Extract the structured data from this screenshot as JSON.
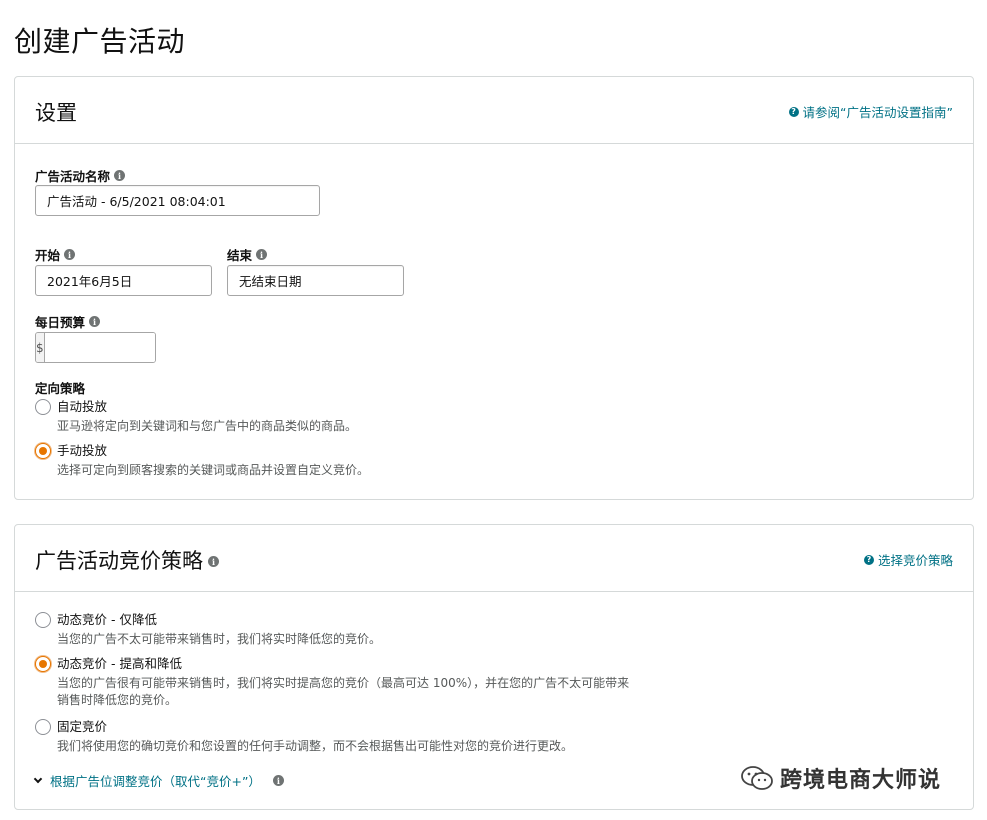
{
  "page_title": "创建广告活动",
  "settings": {
    "title": "设置",
    "help_link": "请参阅“广告活动设置指南”",
    "campaign_name_label": "广告活动名称",
    "campaign_name_value": "广告活动 - 6/5/2021 08:04:01",
    "start_label": "开始",
    "start_value": "2021年6月5日",
    "end_label": "结束",
    "end_value": "无结束日期",
    "budget_label": "每日预算",
    "currency": "$",
    "budget_value": "",
    "targeting_label": "定向策略",
    "targeting_options": [
      {
        "label": "自动投放",
        "desc": "亚马逊将定向到关键词和与您广告中的商品类似的商品。",
        "selected": false
      },
      {
        "label": "手动投放",
        "desc": "选择可定向到顾客搜索的关键词或商品并设置自定义竞价。",
        "selected": true
      }
    ]
  },
  "bidding": {
    "title": "广告活动竞价策略",
    "help_link": "选择竞价策略",
    "options": [
      {
        "label": "动态竞价 - 仅降低",
        "desc": "当您的广告不太可能带来销售时，我们将实时降低您的竞价。",
        "selected": false
      },
      {
        "label": "动态竞价 - 提高和降低",
        "desc": "当您的广告很有可能带来销售时，我们将实时提高您的竞价（最高可达 100%），并在您的广告不太可能带来销售时降低您的竞价。",
        "selected": true
      },
      {
        "label": "固定竞价",
        "desc": "我们将使用您的确切竞价和您设置的任何手动调整，而不会根据售出可能性对您的竞价进行更改。",
        "selected": false
      }
    ],
    "placement_link": "根据广告位调整竞价（取代“竞价+”）"
  },
  "watermark": "跨境电商大师说",
  "colors": {
    "link": "#007185",
    "radio_selected": "#e77600",
    "border": "#d5d9d9"
  }
}
